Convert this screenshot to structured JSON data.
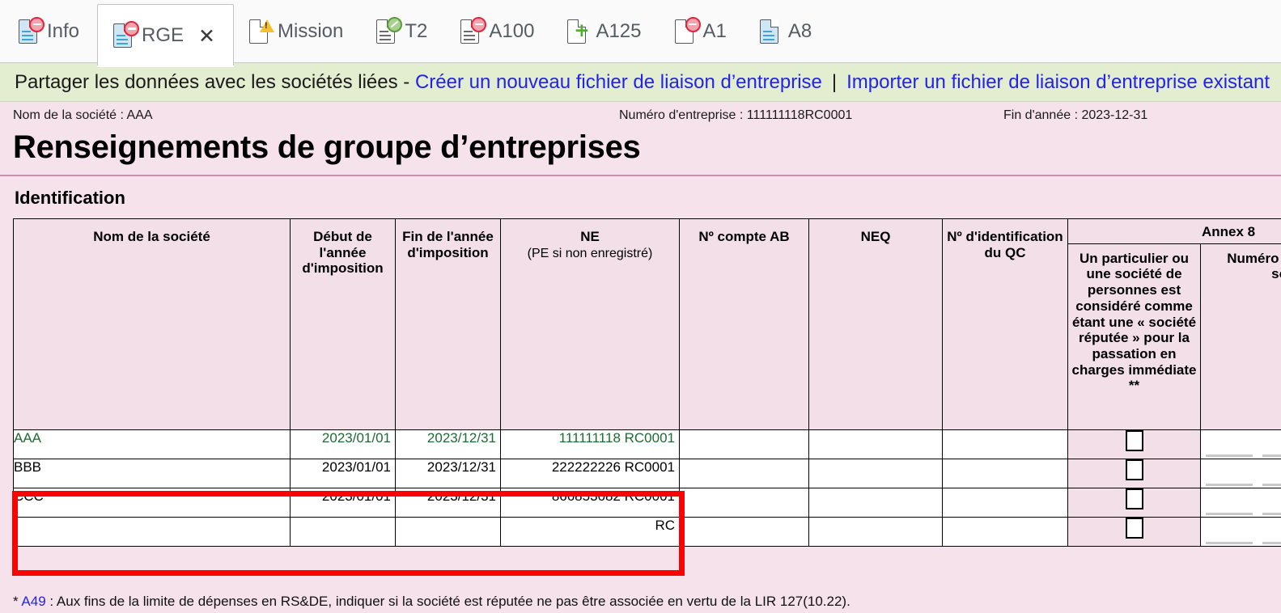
{
  "tabs": [
    {
      "label": "Info",
      "icon": "document-minus-icon",
      "active": false,
      "closable": false
    },
    {
      "label": "RGE",
      "icon": "document-minus-icon",
      "active": true,
      "closable": true
    },
    {
      "label": "Mission",
      "icon": "document-warning-icon",
      "active": false,
      "closable": false
    },
    {
      "label": "T2",
      "icon": "document-edit-icon",
      "active": false,
      "closable": false
    },
    {
      "label": "A100",
      "icon": "document-minus-icon",
      "active": false,
      "closable": false
    },
    {
      "label": "A125",
      "icon": "document-plus-icon",
      "active": false,
      "closable": false
    },
    {
      "label": "A1",
      "icon": "document-minus-icon",
      "active": false,
      "closable": false
    },
    {
      "label": "A8",
      "icon": "document-icon",
      "active": false,
      "closable": false
    }
  ],
  "tab_close_glyph": "✕",
  "sharebar": {
    "prefix": "Partager les données avec les sociétés liées -",
    "link_create": "Créer un nouveau fichier de liaison d’entreprise",
    "separator": "|",
    "link_import": "Importer un fichier de liaison d’entreprise existant"
  },
  "meta": {
    "company_name": "Nom de la société : AAA",
    "business_number": "Numéro d'entreprise : 111111118RC0001",
    "year_end": "Fin d'année : 2023-12-31"
  },
  "page_title": "Renseignements de groupe d’entreprises",
  "section_title": "Identification",
  "table": {
    "headers": {
      "name": "Nom de la société",
      "start": "Début de l'année d'imposition",
      "end": "Fin de l'année d'imposition",
      "ne": "NE",
      "ne_sub": "(PE si non enregistré)",
      "account_ab": "Nº compte AB",
      "neq": "NEQ",
      "qc_id": "Nº d'identification du QC",
      "annex_group": "Annex 8",
      "deemed": "Un particulier ou une société de personnes est considéré comme étant une « société réputée » pour la passation en charges immédiate **",
      "sin": "Numéro d'assurance sociale"
    },
    "rows": [
      {
        "name": "AAA",
        "start": "2023/01/01",
        "end": "2023/12/31",
        "ne": "111111118 RC0001",
        "account_ab": "",
        "neq": "",
        "qc_id": "",
        "deemed_checked": false,
        "sin": "",
        "locked": true
      },
      {
        "name": "BBB",
        "start": "2023/01/01",
        "end": "2023/12/31",
        "ne": "222222226 RC0001",
        "account_ab": "",
        "neq": "",
        "qc_id": "",
        "deemed_checked": false,
        "sin": "",
        "locked": false
      },
      {
        "name": "CCC",
        "start": "2023/01/01",
        "end": "2023/12/31",
        "ne": "866853682 RC0001",
        "account_ab": "",
        "neq": "",
        "qc_id": "",
        "deemed_checked": false,
        "sin": "",
        "locked": false
      },
      {
        "name": "",
        "start": "",
        "end": "",
        "ne": "RC",
        "account_ab": "",
        "neq": "",
        "qc_id": "",
        "deemed_checked": false,
        "sin": "",
        "locked": false
      }
    ]
  },
  "footnote": {
    "star": "*",
    "ref": "A49",
    "text": ": Aux fins de la limite de dépenses en RS&DE, indiquer si la société est réputée ne pas être associée en vertu de la LIR 127(10.22)."
  },
  "colors": {
    "link": "#2323e8",
    "form_bg": "#f6e2ea",
    "share_bg": "#e3edd0",
    "highlight": "#ff0000",
    "locked_text": "#1d6b33"
  }
}
